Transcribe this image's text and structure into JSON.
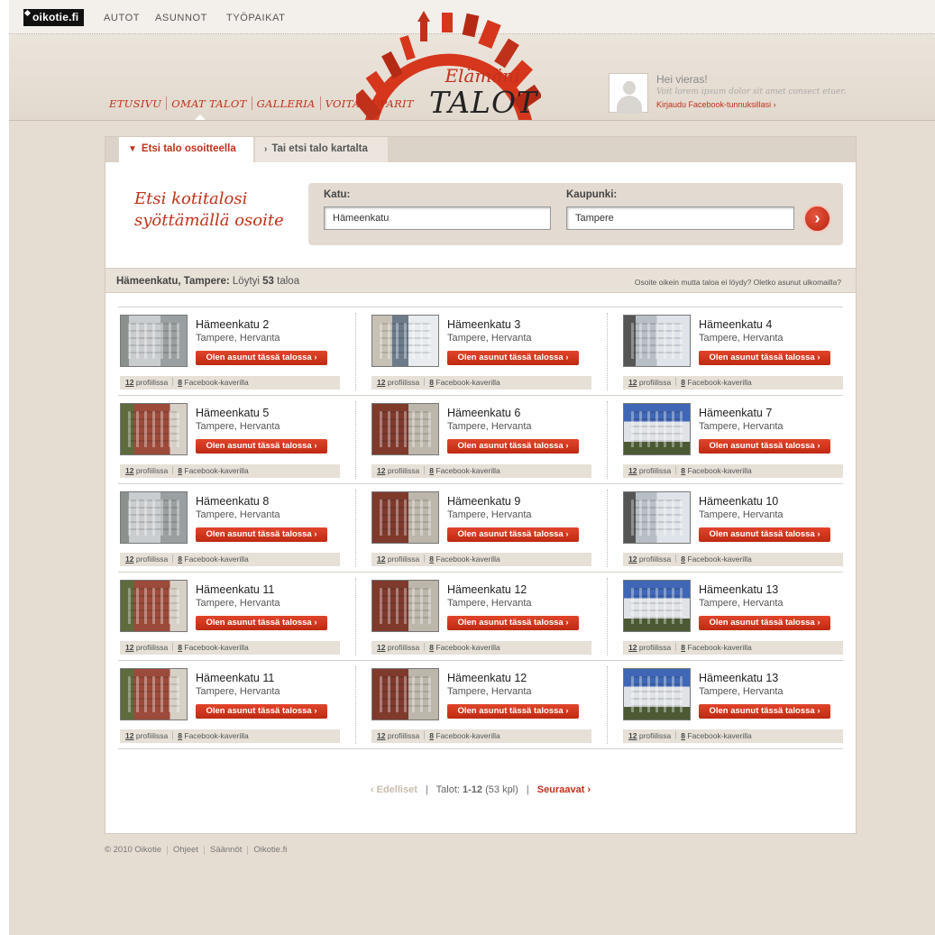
{
  "topbar": {
    "logo": "oikotie.fi",
    "nav": [
      "AUTOT",
      "ASUNNOT",
      "TYÖPAIKAT"
    ]
  },
  "mainnav": [
    "ETUSIVU",
    "OMAT TALOT",
    "GALLERIA",
    "VOITA TUPARIT"
  ],
  "brand": {
    "line1": "Elämäni",
    "line2": "TALOT"
  },
  "user": {
    "greeting": "Hei vieras!",
    "text": "Voit lorem ipsum dolor sit amet consect etuer.",
    "login": "Kirjaudu Facebook-tunnuksillasi ›"
  },
  "tabs": {
    "address": "Etsi talo osoitteella",
    "map": "Tai etsi talo kartalta"
  },
  "search": {
    "slogan1": "Etsi kotitalosi",
    "slogan2": "syöttämällä osoite",
    "street_label": "Katu:",
    "street_value": "Hämeenkatu",
    "city_label": "Kaupunki:",
    "city_value": "Tampere",
    "go": "›"
  },
  "results": {
    "query": "Hämeenkatu, Tampere:",
    "found_prefix": "Löytyi",
    "found_count": "53",
    "found_suffix": "taloa",
    "note": "Osoite oikein mutta taloa ei löydy? Oletko asunut ulkomailla?"
  },
  "listing": {
    "district": "Tampere, Hervanta",
    "button": "Olen asunut tässä talossa ›",
    "profiles_count": "12",
    "profiles_label": "profiilissa",
    "friends_count": "8",
    "friends_label": "Facebook-kaverilla",
    "rows": [
      [
        "Hämeenkatu 2",
        "Hämeenkatu 3",
        "Hämeenkatu 4"
      ],
      [
        "Hämeenkatu 5",
        "Hämeenkatu 6",
        "Hämeenkatu 7"
      ],
      [
        "Hämeenkatu 8",
        "Hämeenkatu 9",
        "Hämeenkatu 10"
      ],
      [
        "Hämeenkatu 11",
        "Hämeenkatu 12",
        "Hämeenkatu 13"
      ],
      [
        "Hämeenkatu 11",
        "Hämeenkatu 12",
        "Hämeenkatu 13"
      ]
    ]
  },
  "pager": {
    "prev": "‹ Edelliset",
    "label": "Talot:",
    "range": "1-12",
    "total": "(53 kpl)",
    "next": "Seuraavat ›"
  },
  "footer": [
    "© 2010 Oikotie",
    "Ohjeet",
    "Säännöt",
    "Oikotie.fi"
  ],
  "colors": {
    "accent": "#c0311b",
    "background": "#e6ddd2"
  }
}
